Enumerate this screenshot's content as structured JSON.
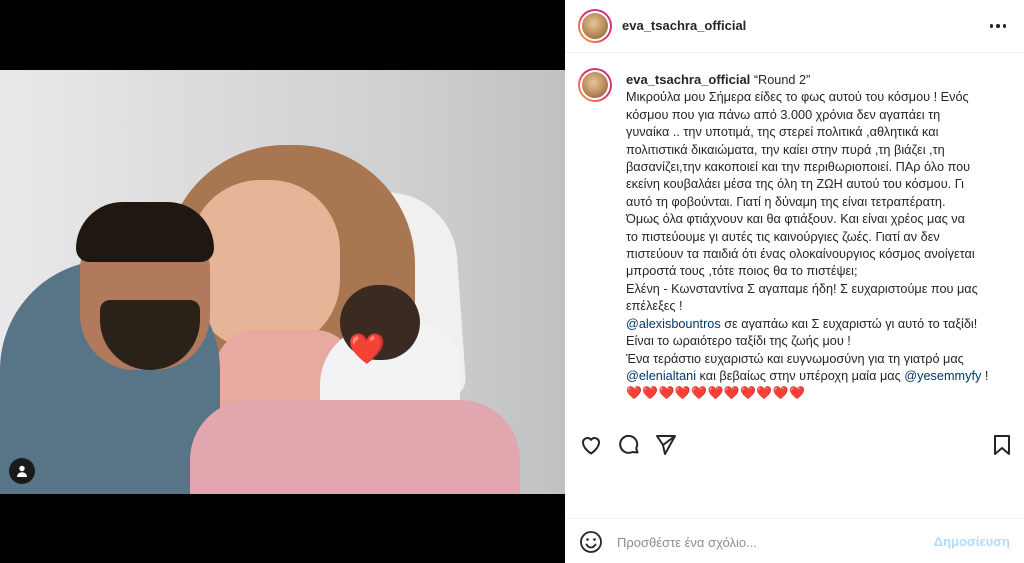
{
  "post": {
    "username": "eva_tsachra_official",
    "caption_title": "“Round 2”",
    "caption_lines": [
      "Μικρούλα μου Σήμερα είδες το φως αυτού του κόσμου ! Ενός",
      "κόσμου που για πάνω από 3.000 χρόνια δεν αγαπάει τη",
      "γυναίκα .. την υποτιμά, της στερεί πολιτικά ,αθλητικά και",
      "πολιτιστικά δικαιώματα, την καίει στην πυρά ,τη βιάζει ,τη",
      "βασανίζει,την κακοποιεί και την περιθωριοποιεί. ΠΑρ όλο που",
      "εκείνη κουβαλάει μέσα της όλη τη ΖΩΗ αυτού του κόσμου. Γι",
      "αυτό τη φοβούνται. Γιατί η δύναμη της είναι τετραπέρατη.",
      "Όμως όλα φτιάχνουν και θα φτιάξουν. Και είναι χρέος μας να",
      "το πιστεύουμε γι αυτές τις καινούργιες ζωές. Γιατί αν δεν",
      "πιστεύουν τα παιδιά ότι ένας ολοκαίνουργιος κόσμος ανοίγεται",
      "μπροστά τους ,τότε ποιος θα το πιστέψει;",
      "Ελένη - Κωνσταντίνα Σ αγαπαμε ήδη! Σ ευχαριστούμε που μας",
      "επέλεξες !"
    ],
    "mention_alexis": "@alexisbountros",
    "line_alexis_rest": " σε αγαπάω και Σ ευχαριστώ γι αυτό το ταξίδι!",
    "line_trip": "Είναι το ωραιότερο ταξίδι της ζωής μου !",
    "line_thanks": "Ένα τεράστιο ευχαριστώ και ευγνωμοσύνη για τη γιατρό μας",
    "mention_elenia": "@elenialtani",
    "line_elenia_rest": " και βεβαίως στην υπέροχη μαία μας ",
    "mention_yesemmy": "@yesemmyfy",
    "line_end": " !",
    "hearts": "❤️❤️❤️❤️❤️❤️❤️❤️❤️❤️❤️",
    "photo_sticker": "❤️"
  },
  "comment": {
    "placeholder": "Προσθέστε ένα σχόλιο...",
    "post_label": "Δημοσίευση"
  },
  "icons": {
    "like": "heart-icon",
    "comment": "comment-icon",
    "share": "send-icon",
    "save": "bookmark-icon",
    "more": "more-options-icon",
    "emoji": "emoji-icon",
    "tags": "user-tag-icon"
  },
  "colors": {
    "mention": "#00376b",
    "post_button": "#b3dbff",
    "placeholder": "#8e8e8e"
  }
}
